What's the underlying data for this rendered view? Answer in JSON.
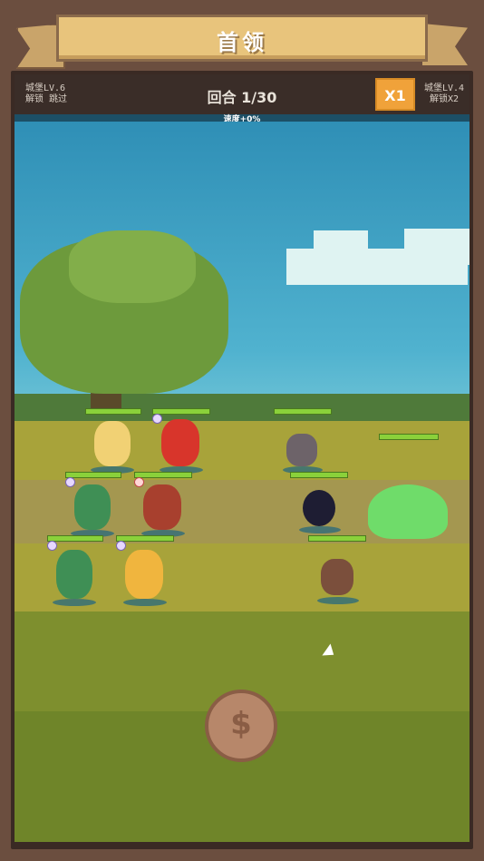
{
  "header": {
    "title": "首领"
  },
  "info": {
    "left_castle": "城堡LV.6",
    "left_unlock": "解锁 跳过",
    "round": "回合 1/30",
    "speed": "X1",
    "right_castle": "城堡LV.4",
    "right_unlock": "解锁X2",
    "speed_bonus": "速度+0%"
  },
  "colors": {
    "accent": "#f0a23a",
    "banner": "#e8c47c",
    "hp": "#8ad13a"
  },
  "icons": {
    "cursor": "cursor-arrow-icon",
    "coin_bag": "money-bag-icon"
  }
}
